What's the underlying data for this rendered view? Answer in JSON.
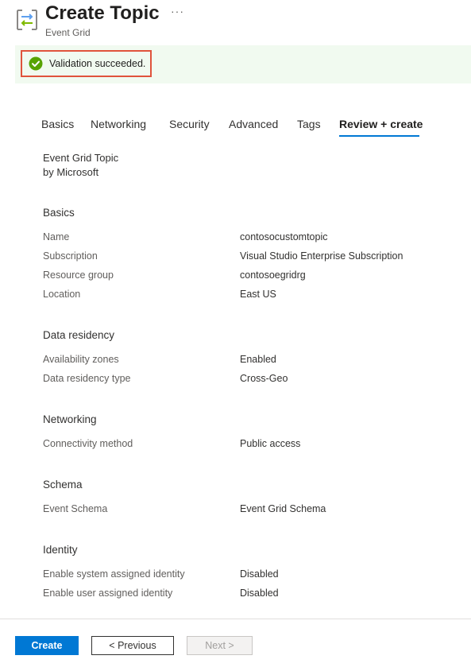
{
  "header": {
    "title": "Create Topic",
    "subtitle": "Event Grid",
    "more_label": "···"
  },
  "banner": {
    "text": "Validation succeeded.",
    "status_color": "#107c10"
  },
  "tabs": [
    {
      "label": "Basics"
    },
    {
      "label": "Networking"
    },
    {
      "label": "Security"
    },
    {
      "label": "Advanced"
    },
    {
      "label": "Tags"
    },
    {
      "label": "Review + create",
      "active": true
    }
  ],
  "product": {
    "name": "Event Grid Topic",
    "publisher": "by Microsoft"
  },
  "sections": {
    "basics": {
      "title": "Basics",
      "rows": [
        {
          "label": "Name",
          "value": "contosocustomtopic"
        },
        {
          "label": "Subscription",
          "value": "Visual Studio Enterprise Subscription"
        },
        {
          "label": "Resource group",
          "value": "contosoegridrg"
        },
        {
          "label": "Location",
          "value": "East US"
        }
      ]
    },
    "data_residency": {
      "title": "Data residency",
      "rows": [
        {
          "label": "Availability zones",
          "value": "Enabled"
        },
        {
          "label": "Data residency type",
          "value": "Cross-Geo"
        }
      ]
    },
    "networking": {
      "title": "Networking",
      "rows": [
        {
          "label": "Connectivity method",
          "value": "Public access"
        }
      ]
    },
    "schema": {
      "title": "Schema",
      "rows": [
        {
          "label": "Event Schema",
          "value": "Event Grid Schema"
        }
      ]
    },
    "identity": {
      "title": "Identity",
      "rows": [
        {
          "label": "Enable system assigned identity",
          "value": "Disabled"
        },
        {
          "label": "Enable user assigned identity",
          "value": "Disabled"
        }
      ]
    }
  },
  "footer": {
    "create_label": "Create",
    "previous_label": "< Previous",
    "next_label": "Next >"
  },
  "colors": {
    "accent": "#0078d4",
    "validation_border": "#e0533c"
  }
}
